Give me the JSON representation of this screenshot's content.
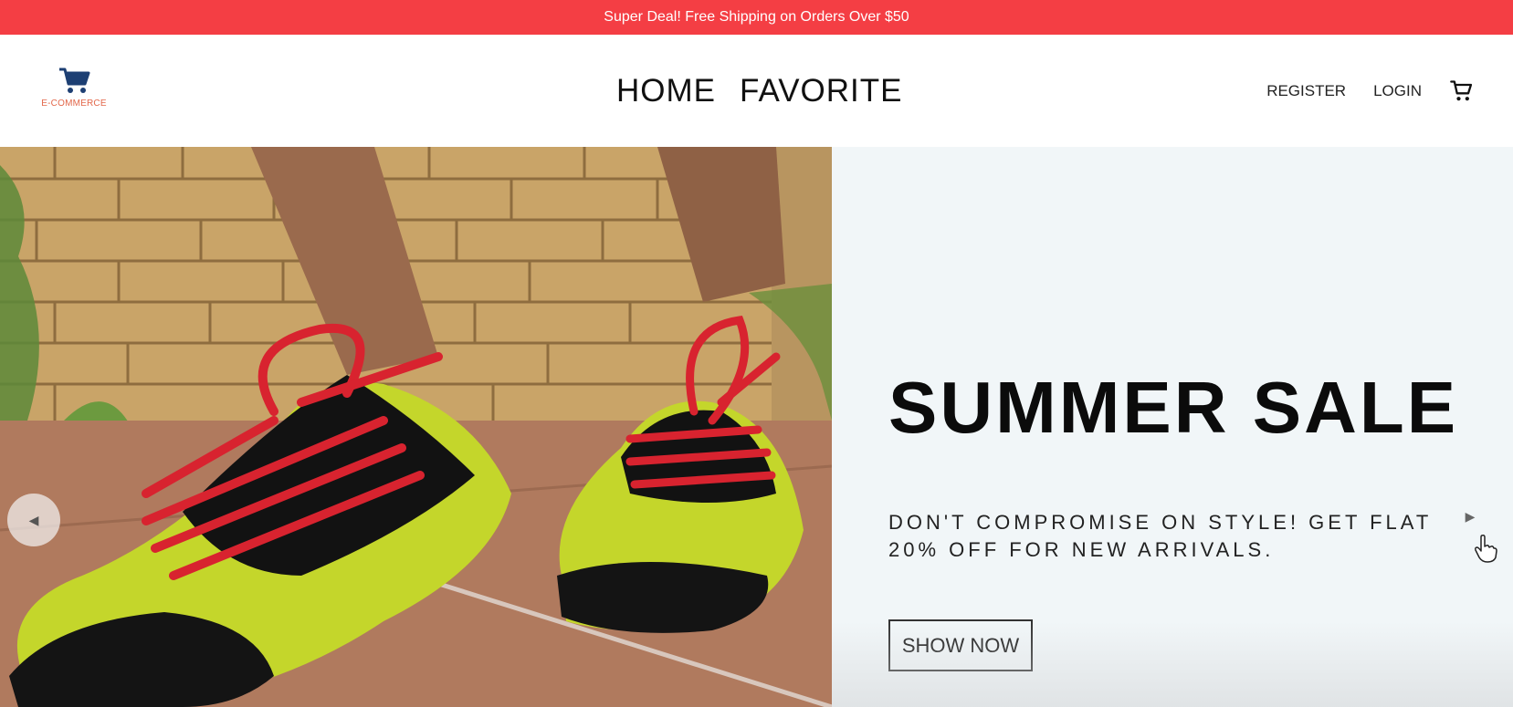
{
  "announcement": {
    "text": "Super Deal! Free Shipping on Orders Over $50"
  },
  "logo": {
    "icon": "shopping-cart-icon",
    "text": "E-COMMERCE"
  },
  "nav": {
    "center_links": [
      {
        "label": "HOME"
      },
      {
        "label": "FAVORITE"
      }
    ],
    "register_label": "REGISTER",
    "login_label": "LOGIN",
    "cart_icon": "shopping-cart-icon"
  },
  "hero": {
    "image_alt": "yellow-running-shoes-with-red-laces",
    "title": "SUMMER SALE",
    "description": "DON'T COMPROMISE ON STYLE! GET FLAT 20% OFF FOR NEW ARRIVALS.",
    "button_label": "SHOW NOW",
    "prev_arrow": "◀",
    "next_arrow": "▶",
    "background_color": "#f1f6f8"
  },
  "colors": {
    "announcement_bg": "#f43e44",
    "logo_cart": "#1d3f73",
    "logo_text": "#e2674a"
  }
}
